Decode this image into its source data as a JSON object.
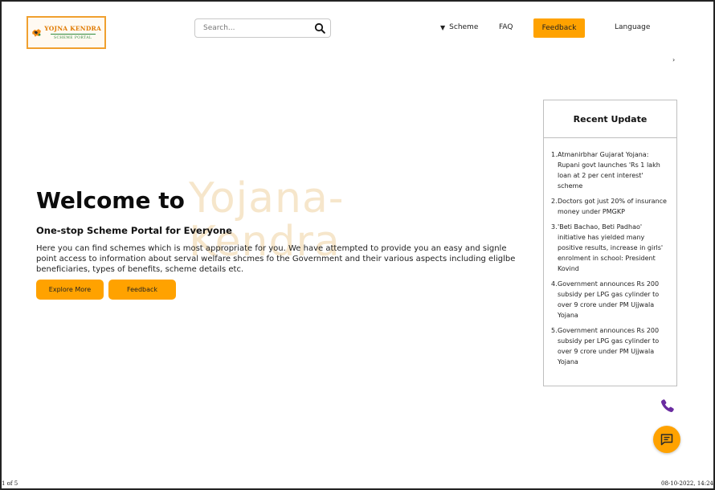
{
  "header": {
    "logo": {
      "title": "YOJNA KENDRA",
      "subtitle": "SCHEME PORTAL"
    },
    "search": {
      "placeholder": "Search..."
    },
    "nav": {
      "scheme_label": "Scheme",
      "faq_label": "FAQ",
      "feedback_label": "Feedback",
      "language_label": "Language"
    }
  },
  "hero": {
    "welcome": "Welcome to",
    "watermark": "Yojana-Kendra",
    "subtitle": "One-stop Scheme Portal for Everyone",
    "description": "Here you can find schemes which is most appropriate for you. We have attempted to provide you an easy and signle point access to information about serval welfare shcmes fo the Government and their various aspects including eliglbe beneficiaries, types of benefits, scheme details etc.",
    "explore_label": "Explore More",
    "feedback_label": "Feedback"
  },
  "recent_update": {
    "title": "Recent Update",
    "items": [
      {
        "num": "1.",
        "text": "Atmanirbhar Gujarat Yojana: Rupani govt launches 'Rs 1 lakh loan at 2 per cent interest' scheme"
      },
      {
        "num": "2.",
        "text": "Doctors got just 20% of insurance money under PMGKP"
      },
      {
        "num": "3.",
        "text": "'Beti Bachao, Beti Padhao' initiative has yielded many positive results, increase in girls' enrolment in school: President Kovind"
      },
      {
        "num": "4.",
        "text": "Government announces Rs 200 subsidy per LPG gas cylinder to over 9 crore under PM Ujjwala Yojana"
      },
      {
        "num": "5.",
        "text": "Government announces Rs 200 subsidy per LPG gas cylinder to over 9 crore under PM Ujjwala Yojana"
      }
    ]
  },
  "footer": {
    "page": "1 of 5",
    "datetime": "08-10-2022, 14:24"
  },
  "colors": {
    "accent": "#ffa200",
    "watermark": "#f6e6cb",
    "phone": "#6a2ca0"
  },
  "icons": [
    "logo-mark",
    "search-icon",
    "caret-down-icon",
    "chevron-right-icon",
    "phone-icon",
    "chat-icon"
  ]
}
